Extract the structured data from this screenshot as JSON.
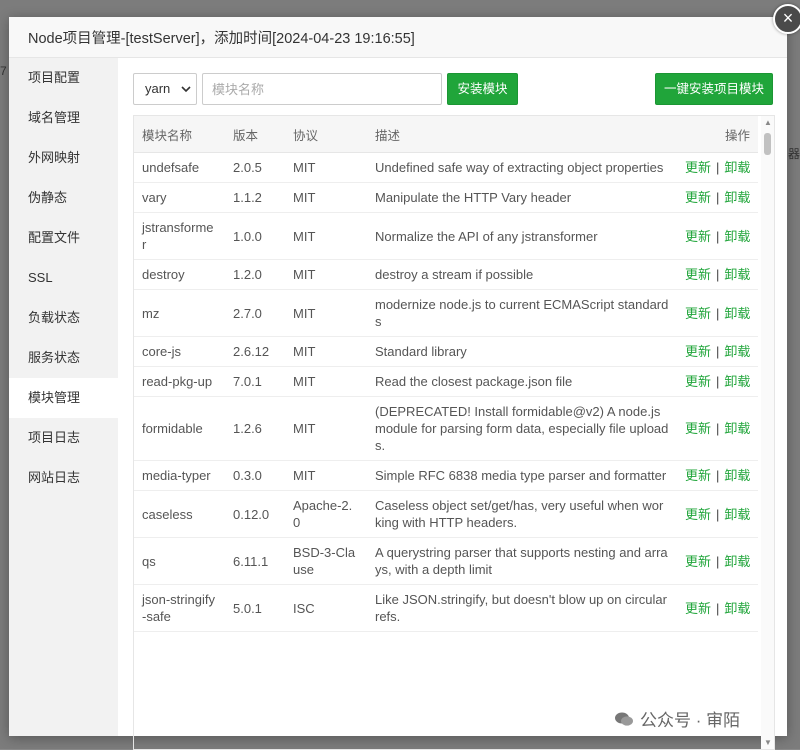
{
  "background": {
    "left_text": "7",
    "right_text": "器"
  },
  "modal": {
    "title": "Node项目管理-[testServer]，添加时间[2024-04-23 19:16:55]",
    "close_symbol": "×"
  },
  "sidebar": {
    "items": [
      {
        "label": "项目配置"
      },
      {
        "label": "域名管理"
      },
      {
        "label": "外网映射"
      },
      {
        "label": "伪静态"
      },
      {
        "label": "配置文件"
      },
      {
        "label": "SSL"
      },
      {
        "label": "负载状态"
      },
      {
        "label": "服务状态"
      },
      {
        "label": "模块管理",
        "active": true
      },
      {
        "label": "项目日志"
      },
      {
        "label": "网站日志"
      }
    ]
  },
  "toolbar": {
    "package_manager": "yarn",
    "module_placeholder": "模块名称",
    "install_label": "安装模块",
    "install_all_label": "一键安装项目模块"
  },
  "table": {
    "headers": {
      "name": "模块名称",
      "version": "版本",
      "license": "协议",
      "desc": "描述",
      "ops": "操作"
    },
    "update_label": "更新",
    "separator": "|",
    "uninstall_label": "卸载",
    "rows": [
      {
        "name": "undefsafe",
        "version": "2.0.5",
        "license": "MIT",
        "desc": "Undefined safe way of extracting object properties"
      },
      {
        "name": "vary",
        "version": "1.1.2",
        "license": "MIT",
        "desc": "Manipulate the HTTP Vary header"
      },
      {
        "name": "jstransformer",
        "version": "1.0.0",
        "license": "MIT",
        "desc": "Normalize the API of any jstransformer"
      },
      {
        "name": "destroy",
        "version": "1.2.0",
        "license": "MIT",
        "desc": "destroy a stream if possible"
      },
      {
        "name": "mz",
        "version": "2.7.0",
        "license": "MIT",
        "desc": "modernize node.js to current ECMAScript standards"
      },
      {
        "name": "core-js",
        "version": "2.6.12",
        "license": "MIT",
        "desc": "Standard library"
      },
      {
        "name": "read-pkg-up",
        "version": "7.0.1",
        "license": "MIT",
        "desc": "Read the closest package.json file"
      },
      {
        "name": "formidable",
        "version": "1.2.6",
        "license": "MIT",
        "desc": "(DEPRECATED! Install formidable@v2) A node.js module for parsing form data, especially file uploads."
      },
      {
        "name": "media-typer",
        "version": "0.3.0",
        "license": "MIT",
        "desc": "Simple RFC 6838 media type parser and formatter"
      },
      {
        "name": "caseless",
        "version": "0.12.0",
        "license": "Apache-2.0",
        "desc": "Caseless object set/get/has, very useful when working with HTTP headers."
      },
      {
        "name": "qs",
        "version": "6.11.1",
        "license": "BSD-3-Clause",
        "desc": "A querystring parser that supports nesting and arrays, with a depth limit"
      },
      {
        "name": "json-stringify-safe",
        "version": "5.0.1",
        "license": "ISC",
        "desc": "Like JSON.stringify, but doesn't blow up on circular refs."
      }
    ]
  },
  "watermark": {
    "text": "公众号 · 审陌"
  }
}
